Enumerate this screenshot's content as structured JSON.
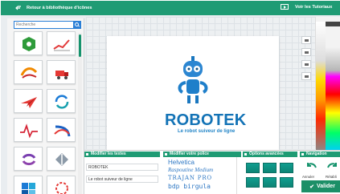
{
  "topbar": {
    "back_label": "Retour à bibliothèque d'icônes",
    "tutorials_label": "Voir les Tutoriaux"
  },
  "library": {
    "search_placeholder": "Recherche",
    "icons": [
      "hexagon-logo-icon",
      "line-chart-icon",
      "swoosh-logo-icon",
      "truck-icon",
      "paper-plane-icon",
      "circular-arrows-icon",
      "heartbeat-logo-icon",
      "globe-swoosh-icon",
      "refresh-arrows-icon",
      "diamond-arrows-icon",
      "puzzle-icon",
      "circle-dots-icon"
    ]
  },
  "logo": {
    "name": "ROBOTEK",
    "tagline": "Le robot suiveur de ligne",
    "colors": {
      "primary": "#1373b6",
      "secondary": "#2486c8"
    }
  },
  "panels": {
    "texts_title": "Modifier les textes",
    "texts_values": [
      "ROBOTEK",
      "Le robot suiveur de ligne"
    ],
    "font_title": "Modifier votre police",
    "fonts": [
      "Helvetica",
      "Raspoutine Medium",
      "TRAJAN PRO",
      "bdp birgula"
    ],
    "options_title": "Options avancées",
    "nav_title": "Navigation",
    "cancel_label": "Annuler",
    "redo_label": "Rétabli",
    "validate_label": "Valider"
  },
  "theme": {
    "accent": "#1f9b74",
    "blue": "#2b7fd6"
  }
}
